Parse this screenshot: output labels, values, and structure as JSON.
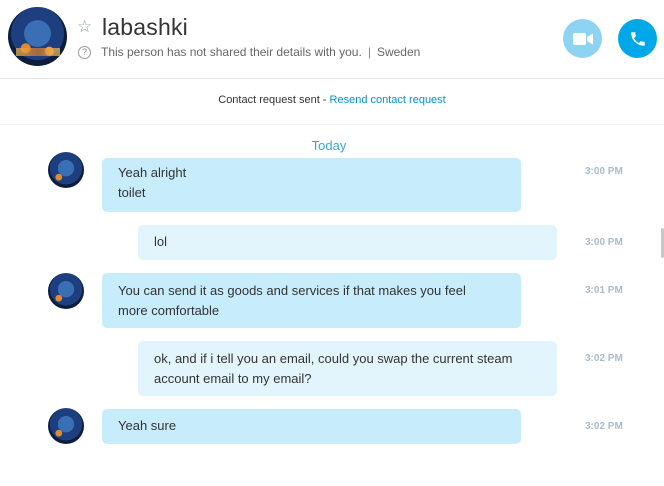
{
  "header": {
    "contact_name": "labashki",
    "details_text": "This person has not shared their details with you.",
    "location": "Sweden",
    "separator": "|"
  },
  "contact_request": {
    "status_text": "Contact request sent",
    "dash": " - ",
    "resend_link": "Resend contact request"
  },
  "chat": {
    "date_divider": "Today",
    "messages": [
      {
        "direction": "incoming",
        "lines": [
          "Yeah alright",
          "toilet"
        ],
        "time": "3:00 PM"
      },
      {
        "direction": "outgoing",
        "lines": [
          "lol"
        ],
        "time": "3:00 PM"
      },
      {
        "direction": "incoming",
        "lines": [
          "You can send it as goods and services if that makes you feel",
          "more comfortable"
        ],
        "time": "3:01 PM"
      },
      {
        "direction": "outgoing",
        "lines": [
          "ok, and if i tell you an email, could you swap the current steam",
          "account email to my email?"
        ],
        "time": "3:02 PM"
      },
      {
        "direction": "incoming",
        "lines": [
          "Yeah sure"
        ],
        "time": "3:02 PM"
      }
    ]
  },
  "icons": {
    "favorite": "star-outline-icon",
    "help": "question-circle-icon",
    "video": "video-camera-icon",
    "call": "phone-icon"
  },
  "colors": {
    "accent": "#00a8e8",
    "video_button": "#8fd3f2",
    "incoming_bubble": "#c7ecfb",
    "outgoing_bubble": "#e3f5fc",
    "link": "#0b8fc9",
    "timestamp": "#a9bccb"
  }
}
